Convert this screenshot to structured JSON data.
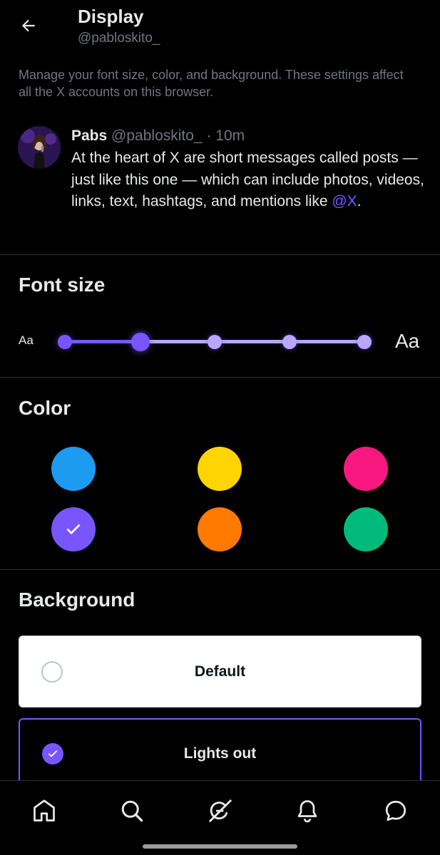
{
  "header": {
    "title": "Display",
    "handle": "@pabloskito_"
  },
  "description": "Manage your font size, color, and background. These settings affect all the X accounts on this browser.",
  "post": {
    "name": "Pabs",
    "handle": "@pabloskito_",
    "dot": "·",
    "time": "10m",
    "text": "At the heart of X are short messages called posts — just like this one — which can include photos, videos, links, text, hashtags, and mentions like ",
    "mention": "@X",
    "text_end": "."
  },
  "font_size": {
    "title": "Font size",
    "small_label": "Aa",
    "large_label": "Aa",
    "stops": 5,
    "selected_index": 1
  },
  "color": {
    "title": "Color",
    "swatches": [
      {
        "name": "blue",
        "hex": "#1d9bf0",
        "selected": false
      },
      {
        "name": "yellow",
        "hex": "#ffd400",
        "selected": false
      },
      {
        "name": "pink",
        "hex": "#f91880",
        "selected": false
      },
      {
        "name": "purple",
        "hex": "#7856ff",
        "selected": true
      },
      {
        "name": "orange",
        "hex": "#ff7a00",
        "selected": false
      },
      {
        "name": "green",
        "hex": "#00ba7c",
        "selected": false
      }
    ]
  },
  "background": {
    "title": "Background",
    "options": [
      {
        "label": "Default",
        "selected": false
      },
      {
        "label": "Lights out",
        "selected": true
      }
    ]
  },
  "nav": {
    "icons": [
      "home-icon",
      "search-icon",
      "grok-icon",
      "notifications-icon",
      "messages-icon"
    ]
  },
  "colors": {
    "accent": "#7856ff",
    "accent_light": "#b9a6ff",
    "muted_text": "#71767b",
    "divider": "#2f3336"
  }
}
